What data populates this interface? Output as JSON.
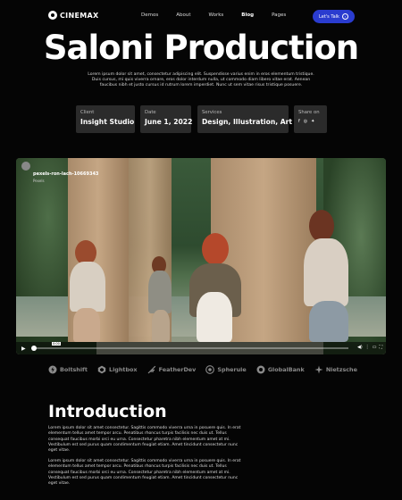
{
  "brand": {
    "name": "CINEMAX"
  },
  "nav": {
    "items": [
      {
        "label": "Demos",
        "active": false
      },
      {
        "label": "About",
        "active": false
      },
      {
        "label": "Works",
        "active": false
      },
      {
        "label": "Blog",
        "active": true
      },
      {
        "label": "Pages",
        "active": false
      }
    ],
    "cta_label": "Let's Talk"
  },
  "hero": {
    "title": "Saloni Production",
    "lede": "Lorem ipsum dolor sit amet, consectetur adipiscing elit. Suspendisse varius enim in eros elementum tristique. Duis cursus, mi quis viverra ornare, eros dolor interdum nulla, ut commodo diam libero vitae erat. Aenean faucibus nibh et justo cursus id rutrum lorem imperdiet. Nunc ut sem vitae risus tristique posuere."
  },
  "meta": {
    "client": {
      "label": "Client",
      "value": "Insight Studio"
    },
    "date": {
      "label": "Date",
      "value": "June 1, 2022"
    },
    "services": {
      "label": "Services",
      "value": "Design, Illustration, Art"
    },
    "share": {
      "label": "Share on",
      "icons": [
        "facebook-icon",
        "instagram-icon",
        "twitter-icon"
      ]
    }
  },
  "video": {
    "author_name": "pexels-ron-lach-10669343",
    "author_sub": "Pexels",
    "time_tip": "0:00",
    "progress": 0.0
  },
  "logos": [
    "Boltshift",
    "Lightbox",
    "FeatherDev",
    "Spherule",
    "GlobalBank",
    "Nietzsche"
  ],
  "intro": {
    "heading": "Introduction",
    "paragraph_1": "Lorem ipsum dolor sit amet consectetur. Sagittis commodo viverra urna in posuere quis. In erat elementum tellus amet tempor arcu. Penatibus rhoncus turpis facilisis nec duis ut. Tellus consequat faucibus morbi orci eu urna. Consectetur pharetra nibh elementum amet at mi. Vestibulum est sed purus quam condimentum feugiat etiam. Amet tincidunt consectetur nunc eget vitae.",
    "paragraph_2": "Lorem ipsum dolor sit amet consectetur. Sagittis commodo viverra urna in posuere quis. In erat elementum tellus amet tempor arcu. Penatibus rhoncus turpis facilisis nec duis ut. Tellus consequat faucibus morbi orci eu urna. Consectetur pharetra nibh elementum amet at mi. Vestibulum est sed purus quam condimentum feugiat etiam. Amet tincidunt consectetur nunc eget vitae."
  },
  "colors": {
    "accent": "#2a3ccf",
    "background": "#050505",
    "card": "#2b2b2b",
    "muted_logo": "#8a8a8a"
  }
}
